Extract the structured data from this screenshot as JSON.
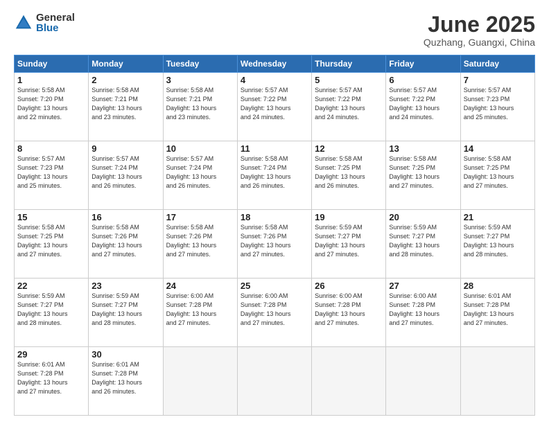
{
  "header": {
    "logo_general": "General",
    "logo_blue": "Blue",
    "month_title": "June 2025",
    "location": "Quzhang, Guangxi, China"
  },
  "days_of_week": [
    "Sunday",
    "Monday",
    "Tuesday",
    "Wednesday",
    "Thursday",
    "Friday",
    "Saturday"
  ],
  "weeks": [
    [
      {
        "num": "1",
        "info": "Sunrise: 5:58 AM\nSunset: 7:20 PM\nDaylight: 13 hours\nand 22 minutes."
      },
      {
        "num": "2",
        "info": "Sunrise: 5:58 AM\nSunset: 7:21 PM\nDaylight: 13 hours\nand 23 minutes."
      },
      {
        "num": "3",
        "info": "Sunrise: 5:58 AM\nSunset: 7:21 PM\nDaylight: 13 hours\nand 23 minutes."
      },
      {
        "num": "4",
        "info": "Sunrise: 5:57 AM\nSunset: 7:22 PM\nDaylight: 13 hours\nand 24 minutes."
      },
      {
        "num": "5",
        "info": "Sunrise: 5:57 AM\nSunset: 7:22 PM\nDaylight: 13 hours\nand 24 minutes."
      },
      {
        "num": "6",
        "info": "Sunrise: 5:57 AM\nSunset: 7:22 PM\nDaylight: 13 hours\nand 24 minutes."
      },
      {
        "num": "7",
        "info": "Sunrise: 5:57 AM\nSunset: 7:23 PM\nDaylight: 13 hours\nand 25 minutes."
      }
    ],
    [
      {
        "num": "8",
        "info": "Sunrise: 5:57 AM\nSunset: 7:23 PM\nDaylight: 13 hours\nand 25 minutes."
      },
      {
        "num": "9",
        "info": "Sunrise: 5:57 AM\nSunset: 7:24 PM\nDaylight: 13 hours\nand 26 minutes."
      },
      {
        "num": "10",
        "info": "Sunrise: 5:57 AM\nSunset: 7:24 PM\nDaylight: 13 hours\nand 26 minutes."
      },
      {
        "num": "11",
        "info": "Sunrise: 5:58 AM\nSunset: 7:24 PM\nDaylight: 13 hours\nand 26 minutes."
      },
      {
        "num": "12",
        "info": "Sunrise: 5:58 AM\nSunset: 7:25 PM\nDaylight: 13 hours\nand 26 minutes."
      },
      {
        "num": "13",
        "info": "Sunrise: 5:58 AM\nSunset: 7:25 PM\nDaylight: 13 hours\nand 27 minutes."
      },
      {
        "num": "14",
        "info": "Sunrise: 5:58 AM\nSunset: 7:25 PM\nDaylight: 13 hours\nand 27 minutes."
      }
    ],
    [
      {
        "num": "15",
        "info": "Sunrise: 5:58 AM\nSunset: 7:25 PM\nDaylight: 13 hours\nand 27 minutes."
      },
      {
        "num": "16",
        "info": "Sunrise: 5:58 AM\nSunset: 7:26 PM\nDaylight: 13 hours\nand 27 minutes."
      },
      {
        "num": "17",
        "info": "Sunrise: 5:58 AM\nSunset: 7:26 PM\nDaylight: 13 hours\nand 27 minutes."
      },
      {
        "num": "18",
        "info": "Sunrise: 5:58 AM\nSunset: 7:26 PM\nDaylight: 13 hours\nand 27 minutes."
      },
      {
        "num": "19",
        "info": "Sunrise: 5:59 AM\nSunset: 7:27 PM\nDaylight: 13 hours\nand 27 minutes."
      },
      {
        "num": "20",
        "info": "Sunrise: 5:59 AM\nSunset: 7:27 PM\nDaylight: 13 hours\nand 28 minutes."
      },
      {
        "num": "21",
        "info": "Sunrise: 5:59 AM\nSunset: 7:27 PM\nDaylight: 13 hours\nand 28 minutes."
      }
    ],
    [
      {
        "num": "22",
        "info": "Sunrise: 5:59 AM\nSunset: 7:27 PM\nDaylight: 13 hours\nand 28 minutes."
      },
      {
        "num": "23",
        "info": "Sunrise: 5:59 AM\nSunset: 7:27 PM\nDaylight: 13 hours\nand 28 minutes."
      },
      {
        "num": "24",
        "info": "Sunrise: 6:00 AM\nSunset: 7:28 PM\nDaylight: 13 hours\nand 27 minutes."
      },
      {
        "num": "25",
        "info": "Sunrise: 6:00 AM\nSunset: 7:28 PM\nDaylight: 13 hours\nand 27 minutes."
      },
      {
        "num": "26",
        "info": "Sunrise: 6:00 AM\nSunset: 7:28 PM\nDaylight: 13 hours\nand 27 minutes."
      },
      {
        "num": "27",
        "info": "Sunrise: 6:00 AM\nSunset: 7:28 PM\nDaylight: 13 hours\nand 27 minutes."
      },
      {
        "num": "28",
        "info": "Sunrise: 6:01 AM\nSunset: 7:28 PM\nDaylight: 13 hours\nand 27 minutes."
      }
    ],
    [
      {
        "num": "29",
        "info": "Sunrise: 6:01 AM\nSunset: 7:28 PM\nDaylight: 13 hours\nand 27 minutes."
      },
      {
        "num": "30",
        "info": "Sunrise: 6:01 AM\nSunset: 7:28 PM\nDaylight: 13 hours\nand 26 minutes."
      },
      {
        "num": "",
        "info": ""
      },
      {
        "num": "",
        "info": ""
      },
      {
        "num": "",
        "info": ""
      },
      {
        "num": "",
        "info": ""
      },
      {
        "num": "",
        "info": ""
      }
    ]
  ]
}
